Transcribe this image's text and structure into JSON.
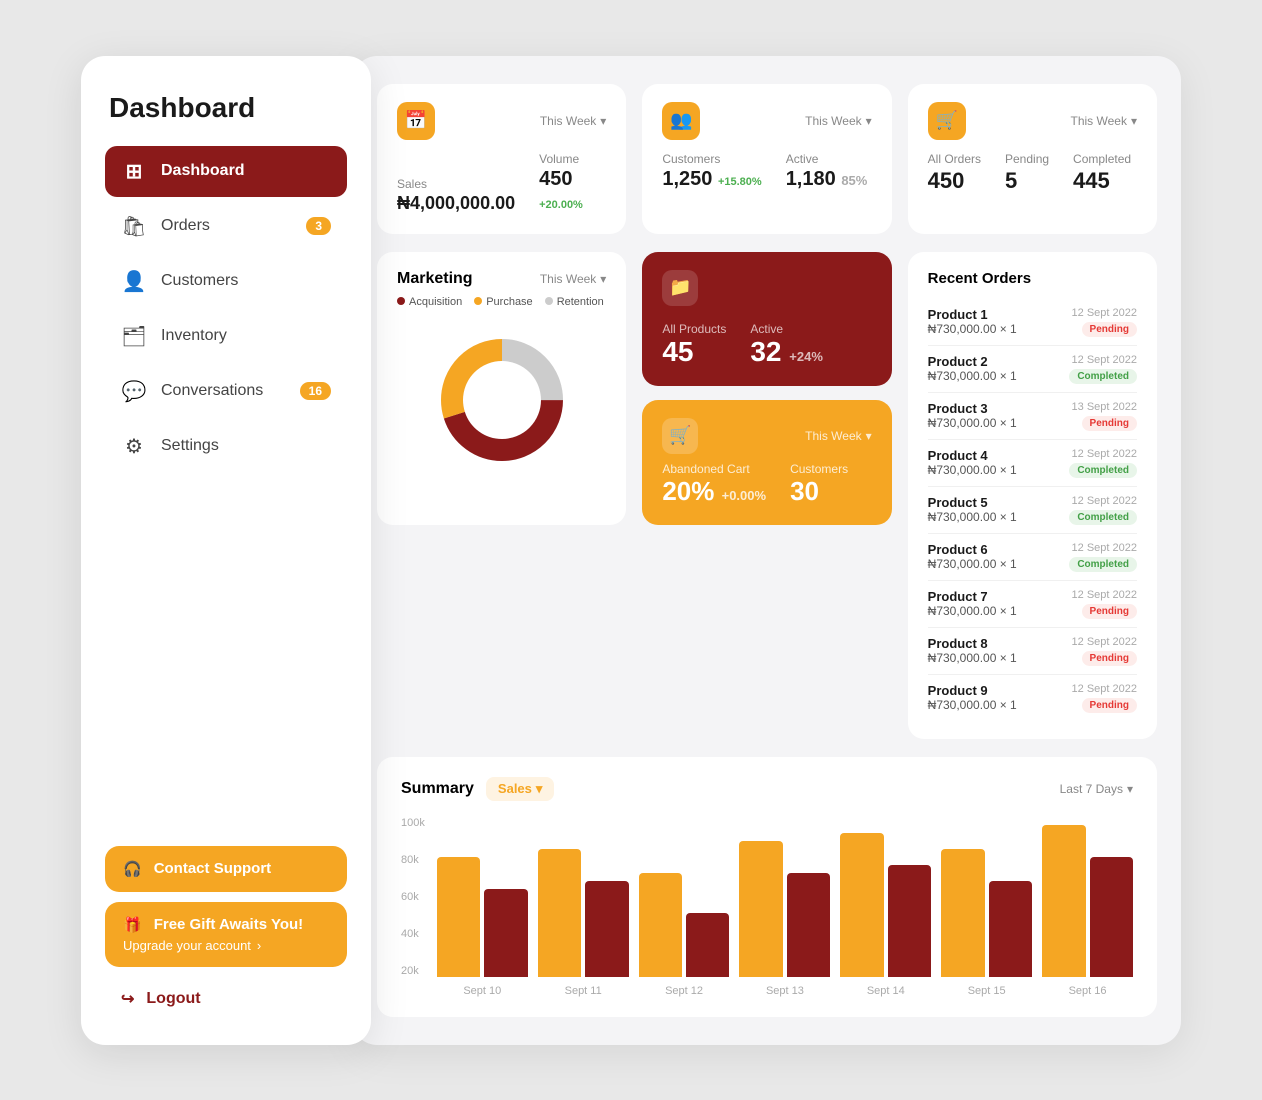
{
  "sidebar": {
    "title": "Dashboard",
    "nav_items": [
      {
        "id": "dashboard",
        "label": "Dashboard",
        "icon": "⊞",
        "active": true,
        "badge": null
      },
      {
        "id": "orders",
        "label": "Orders",
        "icon": "🛍",
        "active": false,
        "badge": "3"
      },
      {
        "id": "customers",
        "label": "Customers",
        "icon": "👤",
        "active": false,
        "badge": null
      },
      {
        "id": "inventory",
        "label": "Inventory",
        "icon": "🗂",
        "active": false,
        "badge": null
      },
      {
        "id": "conversations",
        "label": "Conversations",
        "icon": "💬",
        "active": false,
        "badge": "16"
      },
      {
        "id": "settings",
        "label": "Settings",
        "icon": "⚙",
        "active": false,
        "badge": null
      }
    ],
    "support_btn": "Contact Support",
    "gift_title": "Free Gift Awaits You!",
    "gift_sub": "Upgrade your account",
    "logout_label": "Logout"
  },
  "stats": {
    "sales": {
      "week_label": "This Week",
      "sales_label": "Sales",
      "sales_value": "₦4,000,000.00",
      "volume_label": "Volume",
      "volume_value": "450",
      "volume_change": "+20.00%"
    },
    "customers": {
      "week_label": "This Week",
      "customers_label": "Customers",
      "customers_value": "1,250",
      "customers_change": "+15.80%",
      "active_label": "Active",
      "active_value": "1,180",
      "active_pct": "85%"
    },
    "orders": {
      "week_label": "This Week",
      "all_orders_label": "All Orders",
      "all_orders_value": "450",
      "pending_label": "Pending",
      "pending_value": "5",
      "completed_label": "Completed",
      "completed_value": "445"
    }
  },
  "marketing": {
    "title": "Marketing",
    "week_label": "This Week",
    "legend": [
      {
        "label": "Acquisition",
        "color": "#8b1a1a"
      },
      {
        "label": "Purchase",
        "color": "#f5a623"
      },
      {
        "label": "Retention",
        "color": "#ccc"
      }
    ],
    "donut": {
      "acquisition_pct": 45,
      "purchase_pct": 30,
      "retention_pct": 25
    }
  },
  "products": {
    "all_label": "All Products",
    "all_value": "45",
    "active_label": "Active",
    "active_value": "32",
    "active_change": "+24%"
  },
  "cart": {
    "week_label": "This Week",
    "abandoned_label": "Abandoned Cart",
    "abandoned_value": "20%",
    "abandoned_change": "+0.00%",
    "customers_label": "Customers",
    "customers_value": "30"
  },
  "recent_orders": {
    "title": "Recent Orders",
    "items": [
      {
        "name": "Product 1",
        "price": "₦730,000.00 × 1",
        "date": "12 Sept 2022",
        "status": "Pending"
      },
      {
        "name": "Product 2",
        "price": "₦730,000.00 × 1",
        "date": "12 Sept 2022",
        "status": "Completed"
      },
      {
        "name": "Product 3",
        "price": "₦730,000.00 × 1",
        "date": "13 Sept 2022",
        "status": "Pending"
      },
      {
        "name": "Product 4",
        "price": "₦730,000.00 × 1",
        "date": "12 Sept 2022",
        "status": "Completed"
      },
      {
        "name": "Product 5",
        "price": "₦730,000.00 × 1",
        "date": "12 Sept 2022",
        "status": "Completed"
      },
      {
        "name": "Product 6",
        "price": "₦730,000.00 × 1",
        "date": "12 Sept 2022",
        "status": "Completed"
      },
      {
        "name": "Product 7",
        "price": "₦730,000.00 × 1",
        "date": "12 Sept 2022",
        "status": "Pending"
      },
      {
        "name": "Product 8",
        "price": "₦730,000.00 × 1",
        "date": "12 Sept 2022",
        "status": "Pending"
      },
      {
        "name": "Product 9",
        "price": "₦730,000.00 × 1",
        "date": "12 Sept 2022",
        "status": "Pending"
      }
    ]
  },
  "summary": {
    "title": "Summary",
    "sales_label": "Sales",
    "period_label": "Last 7 Days",
    "y_labels": [
      "100k",
      "80k",
      "60k",
      "40k",
      "20k"
    ],
    "bars": [
      {
        "label": "Sept 10",
        "yellow": 75,
        "red": 55
      },
      {
        "label": "Sept 11",
        "yellow": 80,
        "red": 60
      },
      {
        "label": "Sept 12",
        "yellow": 65,
        "red": 40
      },
      {
        "label": "Sept 13",
        "yellow": 85,
        "red": 65
      },
      {
        "label": "Sept 14",
        "yellow": 90,
        "red": 70
      },
      {
        "label": "Sept 15",
        "yellow": 80,
        "red": 60
      },
      {
        "label": "Sept 16",
        "yellow": 95,
        "red": 75
      }
    ]
  }
}
